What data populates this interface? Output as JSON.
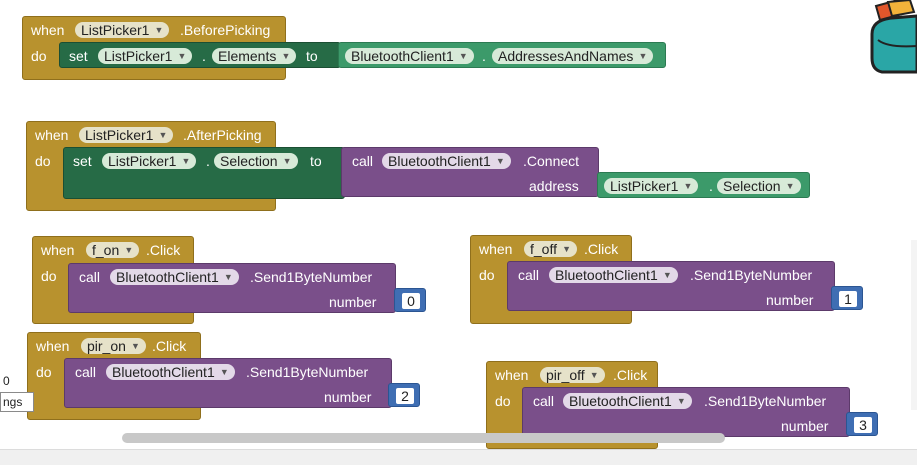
{
  "colors": {
    "event": "#b8922e",
    "set": "#266b46",
    "call": "#7a4f8a",
    "component": "#3c9a6a",
    "number": "#3f6eb3"
  },
  "blocks": {
    "before_picking": {
      "when": "when",
      "component": "ListPicker1",
      "event": ".BeforePicking",
      "do": "do",
      "set": "set",
      "set_component": "ListPicker1",
      "dot": ".",
      "property": "Elements",
      "to": "to",
      "value_component": "BluetoothClient1",
      "value_property": "AddressesAndNames"
    },
    "after_picking": {
      "when": "when",
      "component": "ListPicker1",
      "event": ".AfterPicking",
      "do": "do",
      "set": "set",
      "set_component": "ListPicker1",
      "dot": ".",
      "property": "Selection",
      "to": "to",
      "call": "call",
      "call_component": "BluetoothClient1",
      "method": ".Connect",
      "arg_label": "address",
      "arg_component": "ListPicker1",
      "arg_property": "Selection"
    },
    "f_on": {
      "when": "when",
      "component": "f_on",
      "event": ".Click",
      "do": "do",
      "call": "call",
      "call_component": "BluetoothClient1",
      "method": ".Send1ByteNumber",
      "arg_label": "number",
      "value": "0"
    },
    "f_off": {
      "when": "when",
      "component": "f_off",
      "event": ".Click",
      "do": "do",
      "call": "call",
      "call_component": "BluetoothClient1",
      "method": ".Send1ByteNumber",
      "arg_label": "number",
      "value": "1"
    },
    "pir_on": {
      "when": "when",
      "component": "pir_on",
      "event": ".Click",
      "do": "do",
      "call": "call",
      "call_component": "BluetoothClient1",
      "method": ".Send1ByteNumber",
      "arg_label": "number",
      "value": "2"
    },
    "pir_off": {
      "when": "when",
      "component": "pir_off",
      "event": ".Click",
      "do": "do",
      "call": "call",
      "call_component": "BluetoothClient1",
      "method": ".Send1ByteNumber",
      "arg_label": "number",
      "value": "3"
    }
  },
  "left_panel": {
    "count": "0",
    "field_text": "ngs"
  },
  "icons": {
    "backpack": "backpack-icon"
  }
}
